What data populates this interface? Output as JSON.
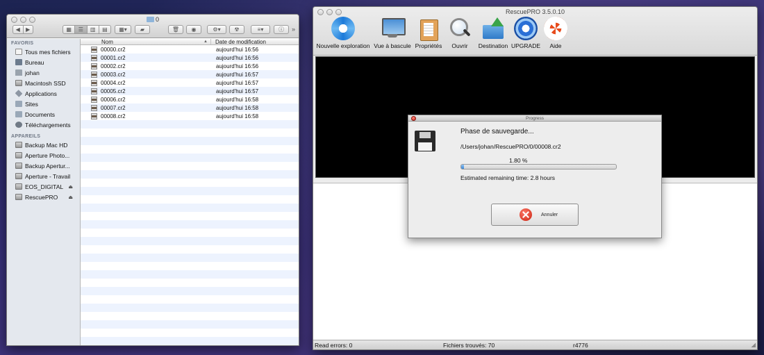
{
  "finder": {
    "title": "0",
    "sidebar": {
      "favorites_heading": "FAVORIS",
      "favorites": [
        {
          "label": "Tous mes fichiers",
          "icon": "all-files-icon"
        },
        {
          "label": "Bureau",
          "icon": "desktop-icon"
        },
        {
          "label": "johan",
          "icon": "home-icon"
        },
        {
          "label": "Macintosh SSD",
          "icon": "drive-icon"
        },
        {
          "label": "Applications",
          "icon": "applications-icon"
        },
        {
          "label": "Sites",
          "icon": "folder-icon"
        },
        {
          "label": "Documents",
          "icon": "folder-icon"
        },
        {
          "label": "Téléchargements",
          "icon": "downloads-icon"
        }
      ],
      "devices_heading": "APPAREILS",
      "devices": [
        {
          "label": "Backup Mac HD",
          "eject": false
        },
        {
          "label": "Aperture Photo...",
          "eject": false
        },
        {
          "label": "Backup Apertur...",
          "eject": false
        },
        {
          "label": "Aperture - Travail",
          "eject": false
        },
        {
          "label": "EOS_DIGITAL",
          "eject": true
        },
        {
          "label": "RescuePRO",
          "eject": true
        }
      ]
    },
    "columns": {
      "name": "Nom",
      "date": "Date de modification"
    },
    "files": [
      {
        "name": "00000.cr2",
        "date": "aujourd'hui 16:56"
      },
      {
        "name": "00001.cr2",
        "date": "aujourd'hui 16:56"
      },
      {
        "name": "00002.cr2",
        "date": "aujourd'hui 16:56"
      },
      {
        "name": "00003.cr2",
        "date": "aujourd'hui 16:57"
      },
      {
        "name": "00004.cr2",
        "date": "aujourd'hui 16:57"
      },
      {
        "name": "00005.cr2",
        "date": "aujourd'hui 16:57"
      },
      {
        "name": "00006.cr2",
        "date": "aujourd'hui 16:58"
      },
      {
        "name": "00007.cr2",
        "date": "aujourd'hui 16:58"
      },
      {
        "name": "00008.cr2",
        "date": "aujourd'hui 16:58"
      }
    ]
  },
  "rescue": {
    "title": "RescuePRO 3.5.0.10",
    "toolbar": [
      {
        "label": "Nouvelle exploration",
        "icon": "refresh-icon"
      },
      {
        "label": "Vue à bascule",
        "icon": "monitor-icon"
      },
      {
        "label": "Propriétés",
        "icon": "clipboard-icon"
      },
      {
        "label": "Ouvrir",
        "icon": "magnifier-icon"
      },
      {
        "label": "Destination",
        "icon": "destination-folder-icon"
      },
      {
        "label": "UPGRADE",
        "icon": "upgrade-icon"
      },
      {
        "label": "Aide",
        "icon": "lifebuoy-icon"
      }
    ],
    "status": {
      "read_errors": "Read errors: 0",
      "files_found": "Fichiers trouvés: 70",
      "revision": "r4776"
    }
  },
  "progress_dialog": {
    "title": "Progress",
    "phase": "Phase de sauvegarde...",
    "path": "/Users/johan/RescuePRO/0/00008.cr2",
    "percent_text": "1.80 %",
    "percent_value": 1.8,
    "remaining": "Estimated remaining time: 2.8 hours",
    "cancel_label": "Annuler"
  }
}
